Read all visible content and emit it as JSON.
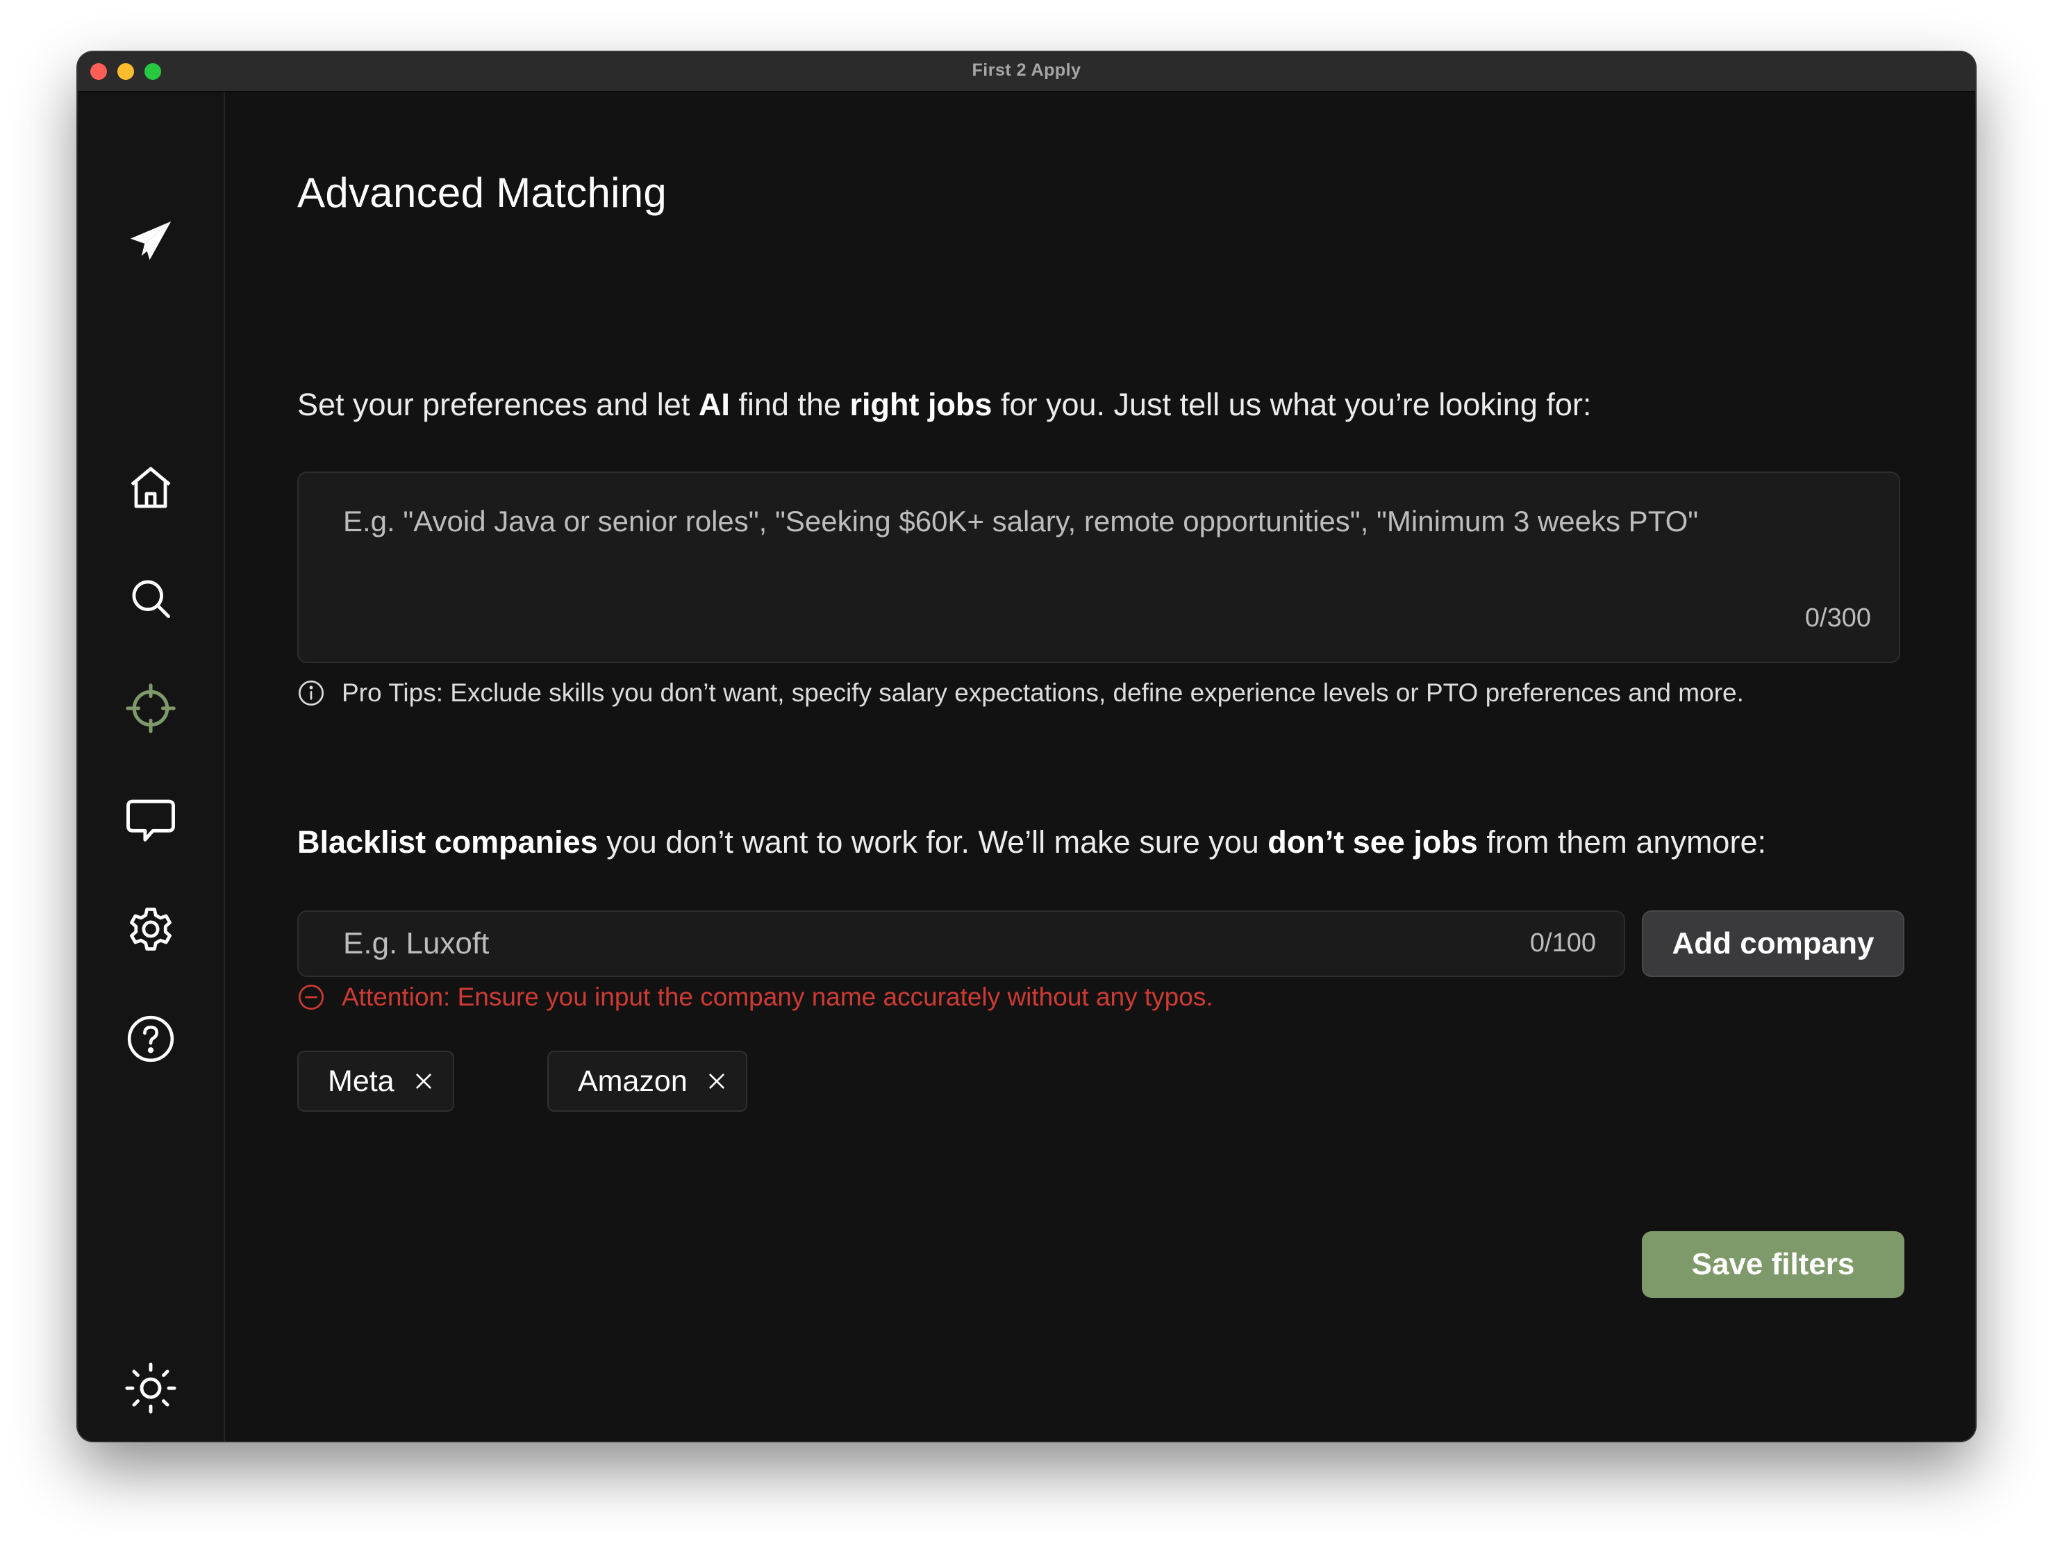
{
  "window": {
    "title": "First 2 Apply"
  },
  "sidebar": {
    "items": [
      {
        "name": "logo",
        "icon": "paper-plane-icon"
      },
      {
        "name": "home",
        "icon": "home-icon"
      },
      {
        "name": "search",
        "icon": "search-icon"
      },
      {
        "name": "advanced-matching",
        "icon": "crosshair-icon",
        "active": true,
        "active_color": "#7f9a6a"
      },
      {
        "name": "feedback",
        "icon": "chat-bubble-icon"
      },
      {
        "name": "settings",
        "icon": "gear-icon"
      },
      {
        "name": "help",
        "icon": "help-circle-icon"
      },
      {
        "name": "theme-toggle",
        "icon": "sun-icon"
      }
    ]
  },
  "main": {
    "title": "Advanced Matching",
    "preferences": {
      "prompt_part1": "Set your preferences and let ",
      "prompt_bold1": "AI",
      "prompt_part2": " find the ",
      "prompt_bold2": "right jobs",
      "prompt_part3": " for you. Just tell us what you’re looking for:",
      "value": "",
      "placeholder": "E.g. \"Avoid Java or senior roles\", \"Seeking $60K+ salary, remote opportunities\", \"Minimum 3 weeks PTO\"",
      "counter": "0/300",
      "tip": "Pro Tips: Exclude skills you don’t want, specify salary expectations, define experience levels or PTO preferences and more."
    },
    "blacklist": {
      "prompt_bold1": "Blacklist companies",
      "prompt_part1": " you don’t want to work for. We’ll make sure you ",
      "prompt_bold2": "don’t see jobs",
      "prompt_part2": " from them anymore:",
      "value": "",
      "placeholder": "E.g. Luxoft",
      "counter": "0/100",
      "add_label": "Add company",
      "attention": "Attention: Ensure you input the company name accurately without any typos.",
      "companies": [
        "Meta",
        "Amazon"
      ]
    },
    "save_label": "Save filters"
  },
  "colors": {
    "background": "#121212",
    "accent": "#7f9a6a",
    "warning": "#cf3b32"
  }
}
